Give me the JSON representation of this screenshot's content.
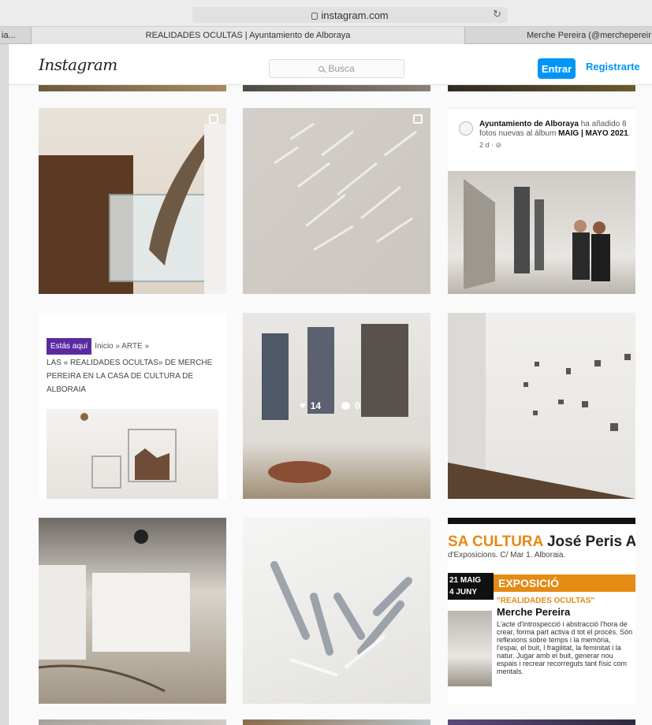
{
  "browser": {
    "url": "instagram.com",
    "tabs": [
      {
        "label": "ia..."
      },
      {
        "label": "REALIDADES OCULTAS | Ayuntamiento de Alboraya"
      },
      {
        "label": "Merche Pereira (@merchepereir"
      }
    ]
  },
  "header": {
    "logo": "Instagram",
    "search_placeholder": "Busca",
    "login_label": "Entrar",
    "register_label": "Registrarte"
  },
  "fb_post": {
    "author": "Ayuntamiento de Alboraya",
    "text_before_album": " ha añadido 8 fotos nuevas al álbum ",
    "album": "MAIG | MAYO 2021",
    "end_mark": ".",
    "meta": "2 d · ⊘"
  },
  "blog": {
    "badge": "Estás aquí",
    "crumbs": "Inicio »  ARTE »",
    "headline": "LAS « REALIDADES OCULTAS» DE MERCHE PEREIRA EN LA CASA DE CULTURA DE ALBORAIA"
  },
  "overlay": {
    "likes": "14",
    "comments": "0"
  },
  "poster": {
    "title_orange": "SA CULTURA",
    "title_black": " José Peris Aragó",
    "subtitle": "d'Exposicions. C/ Mar 1. Alboraia.",
    "date_line1": "21 MAIG",
    "date_line2": "4 JUNY",
    "tag": "EXPOSICIÓ",
    "show_title": "\"REALIDADES OCULTAS\"",
    "artist": "Merche Pereira",
    "body": "L'acte d'introspecció i abstracció l'hora de crear, forma part activa d tot el procés. Són reflexions sobre temps i la memòria, l'espai, el buit, l fragilitat, la feminitat i la natur. Jugar amb el buit, generar nou espais i recrear recorreguts tant físic com mentals."
  }
}
